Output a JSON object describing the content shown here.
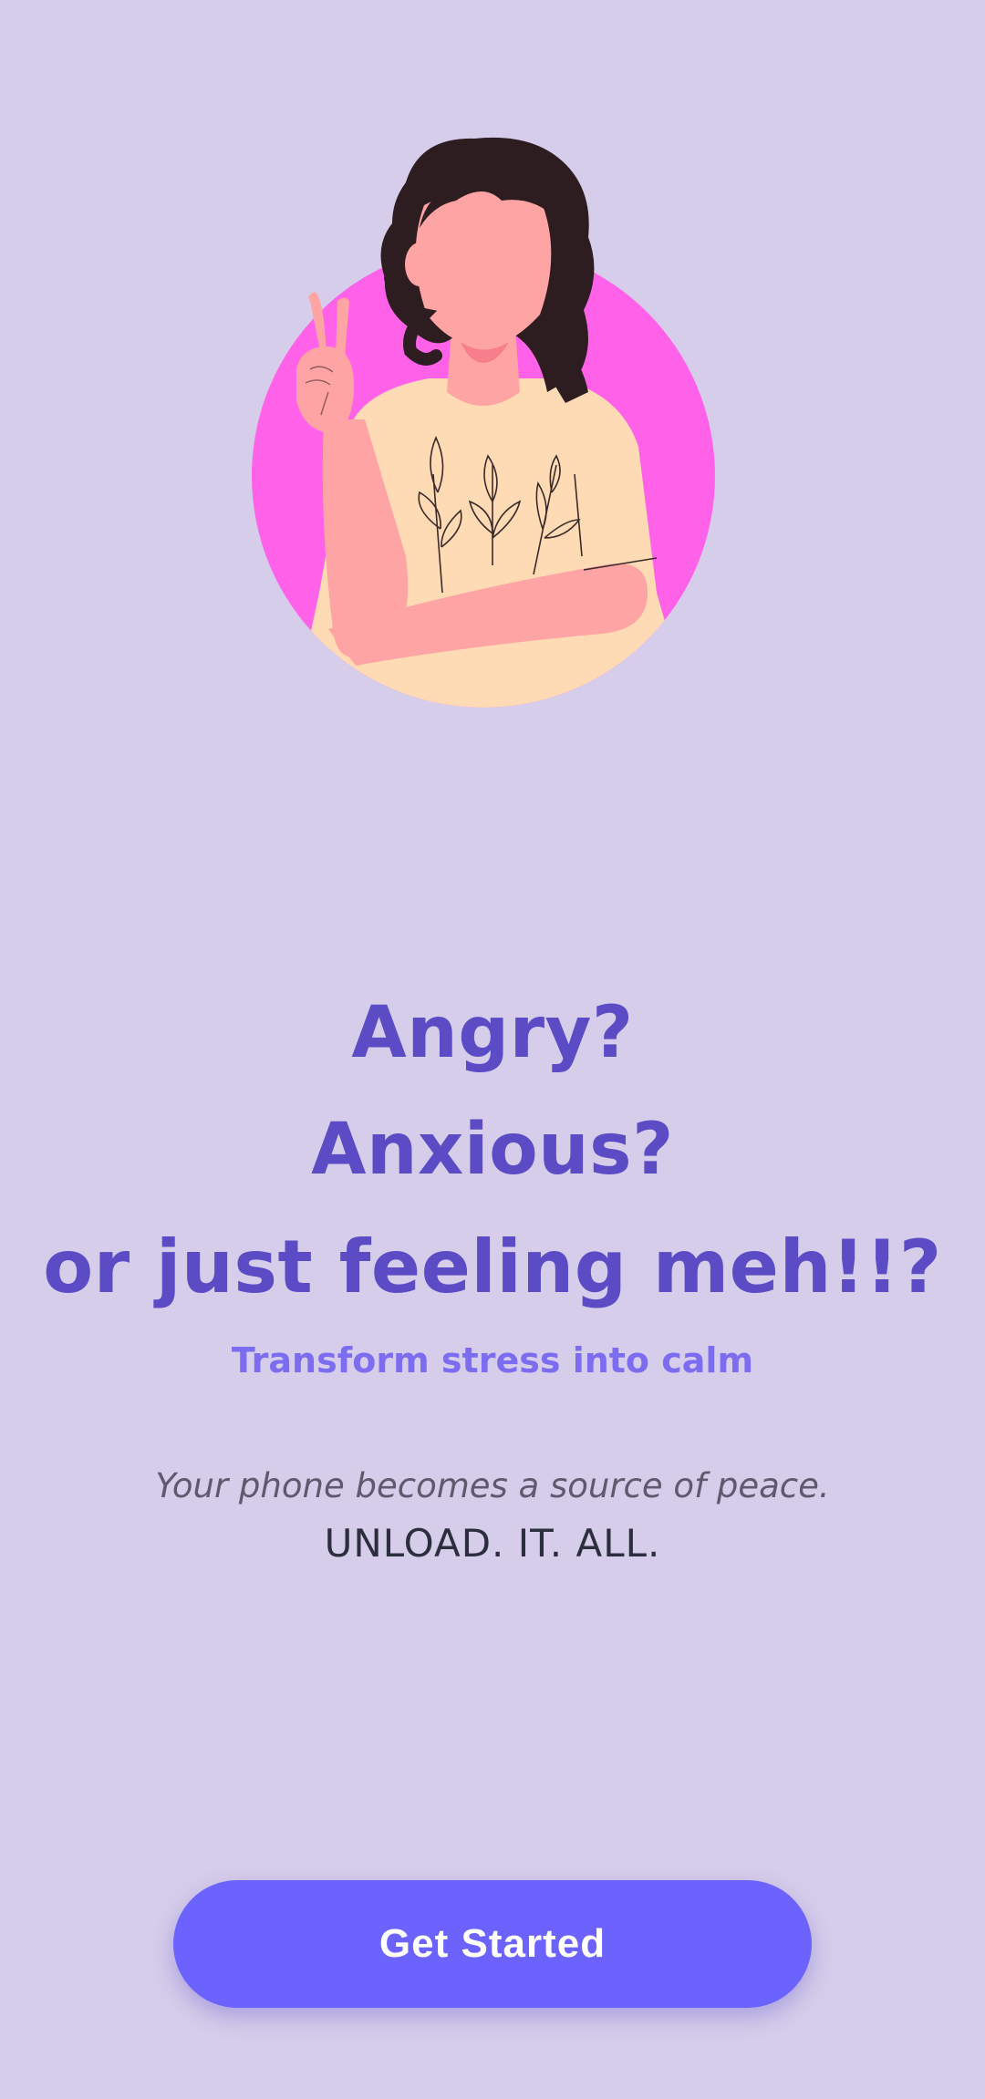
{
  "hero": {
    "illustration": "woman-peace-sign-illustration",
    "accent_circle_color": "#ff62e8"
  },
  "headline": {
    "line1": "Angry?",
    "line2": "Anxious?",
    "line3": "or just feeling meh!!?"
  },
  "subtitle": "Transform stress into calm",
  "body": {
    "tagline": "Your phone becomes a source of peace.",
    "unload": "UNLOAD. IT. ALL."
  },
  "cta": {
    "label": "Get Started",
    "color": "#6c63ff"
  },
  "colors": {
    "background": "#d6cdea",
    "headline": "#5b4cc6",
    "subtitle": "#7b6cf0"
  }
}
